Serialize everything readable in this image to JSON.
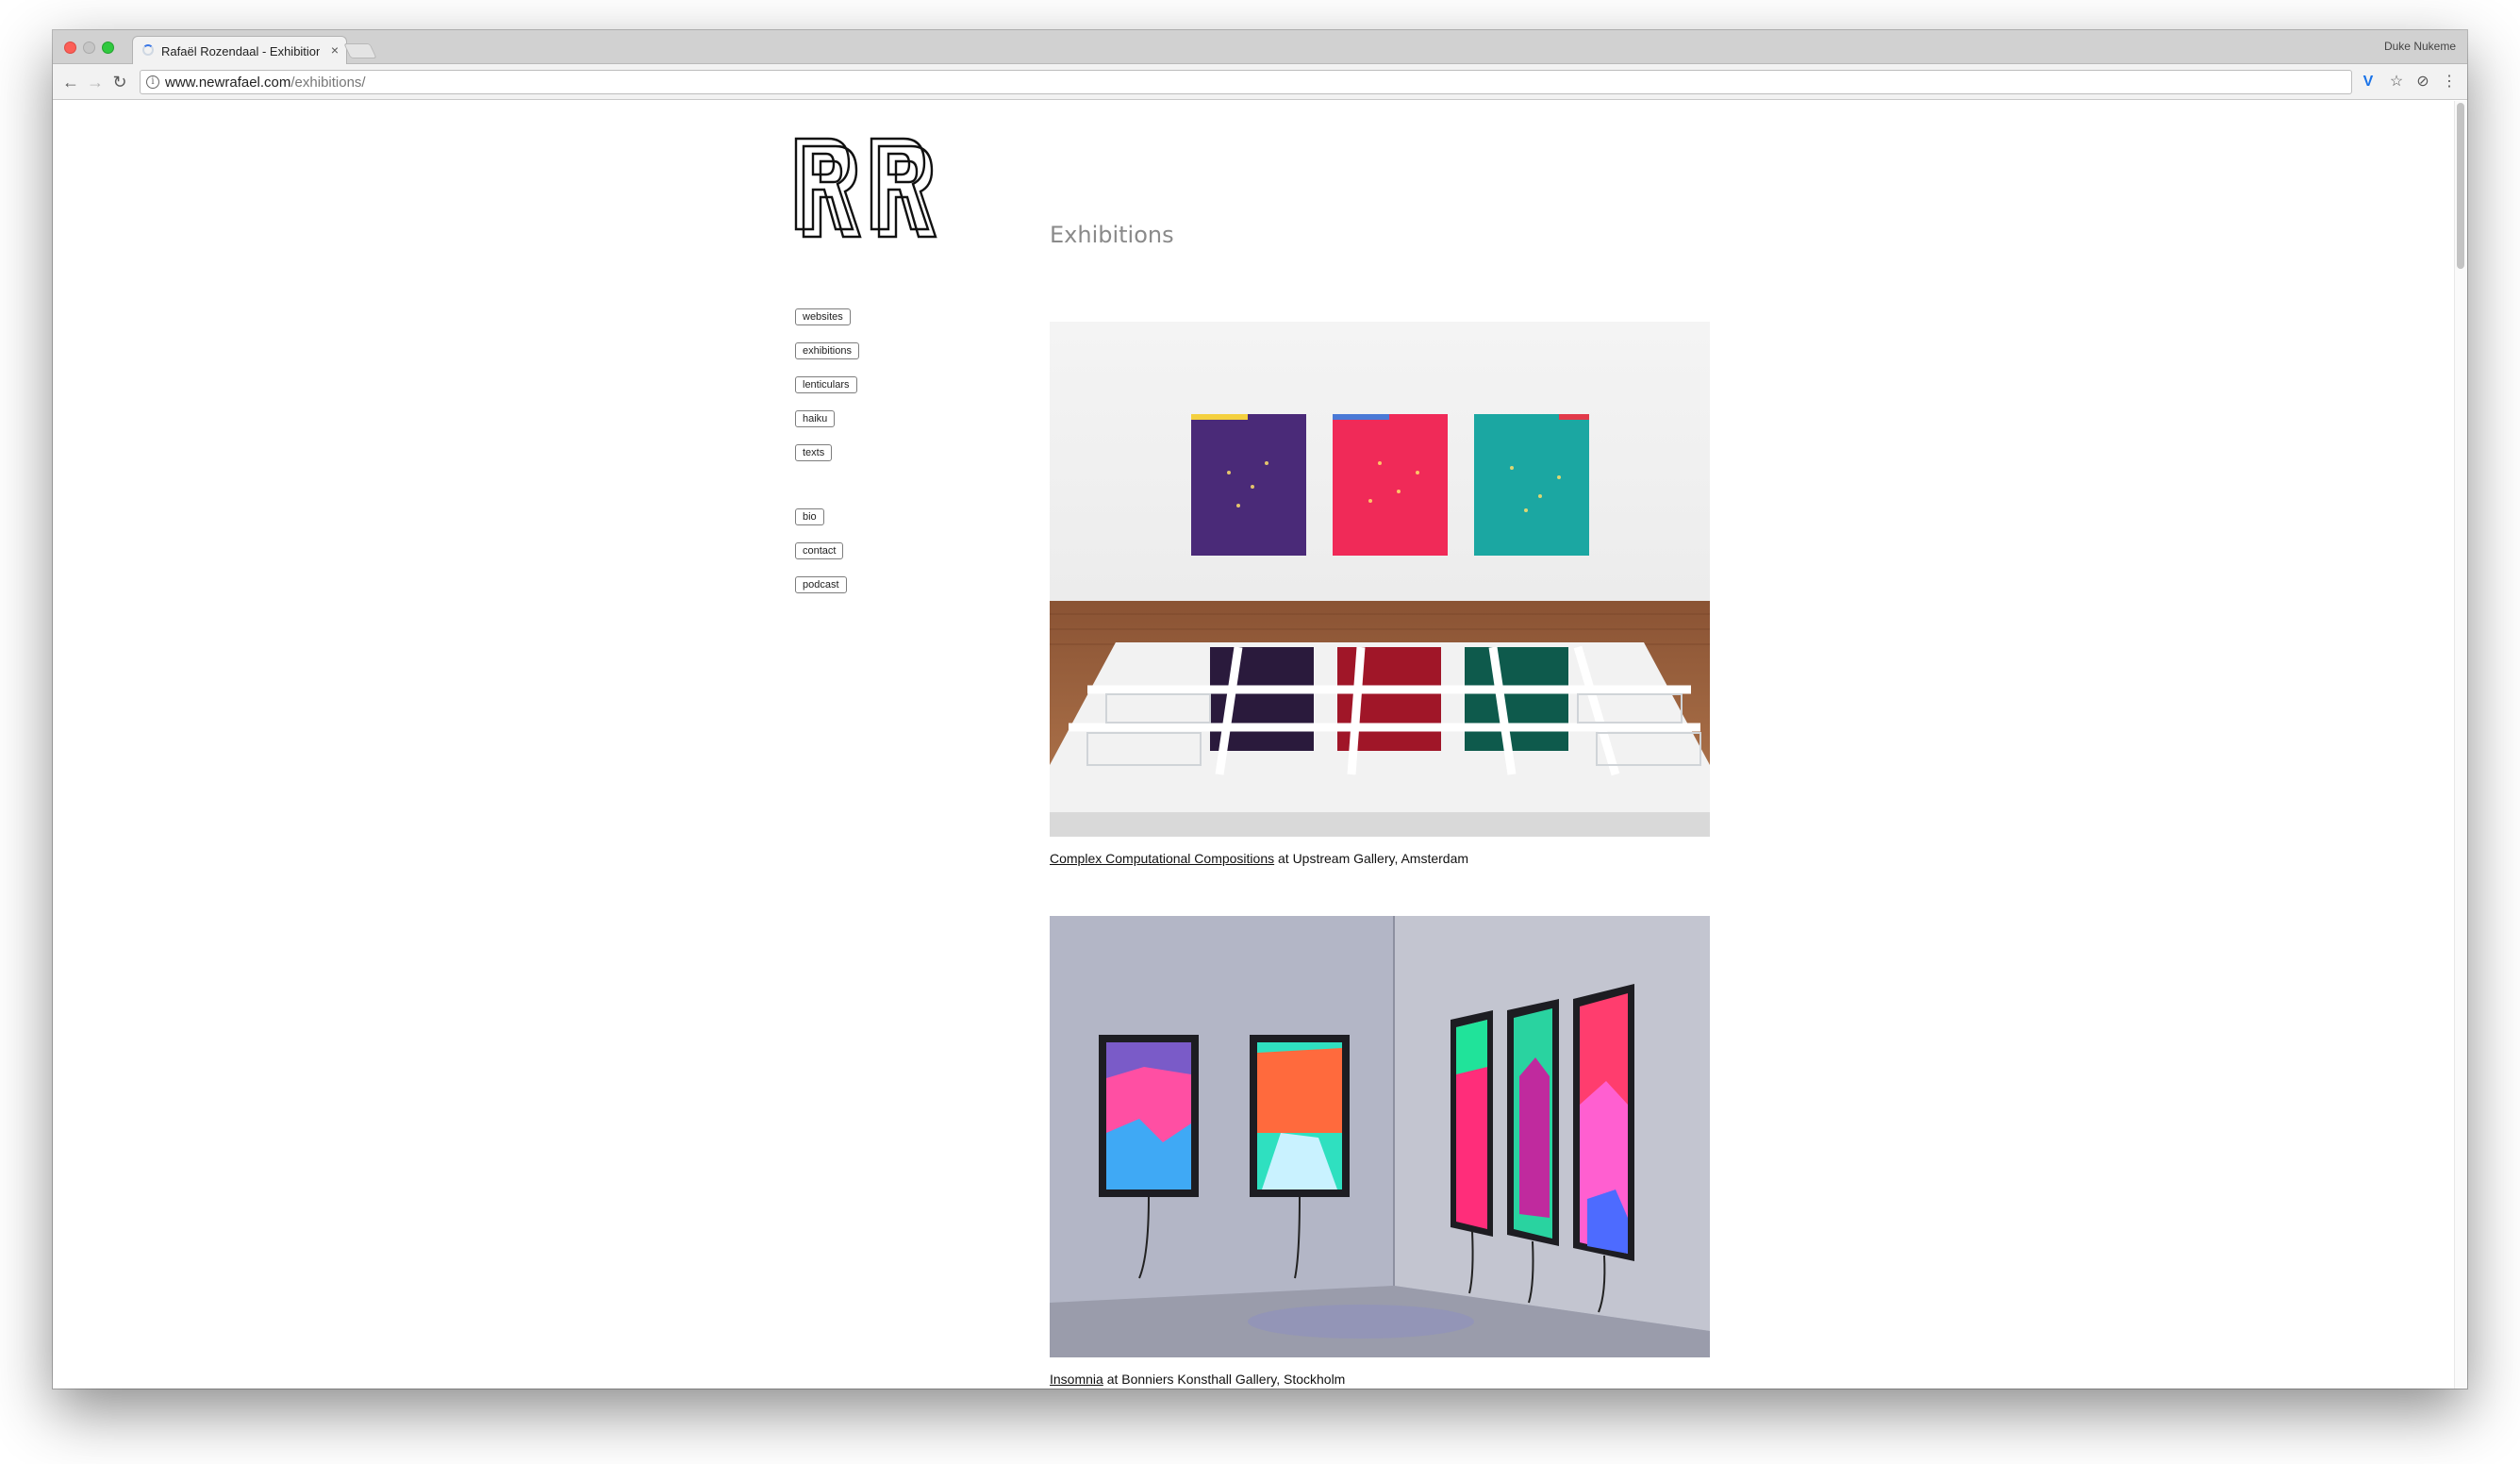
{
  "browser": {
    "tab_title": "Rafaël Rozendaal - Exhibitions",
    "tab_close": "×",
    "profile_name": "Duke Nukeme",
    "url_host": "www.newrafael.com",
    "url_path": "/exhibitions/"
  },
  "toolbar": {
    "back_icon": "←",
    "forward_icon": "→",
    "reload_icon": "↻",
    "info_icon": "i",
    "extension_icon": "V",
    "star_icon": "☆",
    "extension2_icon": "⊘",
    "menu_icon": "⋮"
  },
  "site": {
    "logo_text": "RR",
    "nav_primary": [
      "websites",
      "exhibitions",
      "lenticulars",
      "haiku",
      "texts"
    ],
    "nav_secondary": [
      "bio",
      "contact",
      "podcast"
    ]
  },
  "page": {
    "heading": "Exhibitions",
    "exhibitions": [
      {
        "title": "Complex Computational Compositions",
        "venue_text": " at Upstream Gallery, Amsterdam"
      },
      {
        "title": "Insomnia",
        "venue_text": " at Bonniers Konsthall Gallery, Stockholm"
      }
    ]
  }
}
